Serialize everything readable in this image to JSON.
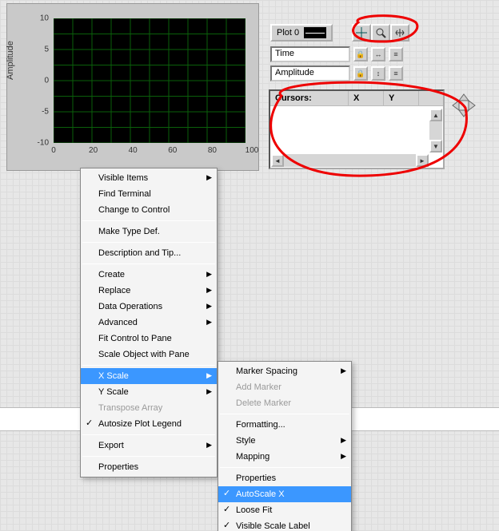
{
  "chart_data": {
    "type": "line",
    "series": [],
    "title": "",
    "xlabel": "Time",
    "ylabel": "Amplitude",
    "xlim": [
      0,
      100
    ],
    "ylim": [
      -10,
      10
    ],
    "xticks": [
      0,
      20,
      40,
      60,
      80,
      100
    ],
    "yticks": [
      -10,
      -5,
      0,
      5,
      10
    ],
    "grid": true,
    "grid_color": "#006400",
    "background": "#000000"
  },
  "legend": {
    "plot0": "Plot 0"
  },
  "palette": {
    "tools": [
      "crosshair-tool",
      "zoom-tool",
      "pan-tool"
    ]
  },
  "scales": {
    "x_label_field": "Time",
    "y_label_field": "Amplitude"
  },
  "cursor_table": {
    "header_cursors": "Cursors:",
    "header_x": "X",
    "header_y": "Y",
    "rows": []
  },
  "context_menu": {
    "items": {
      "visible_items": "Visible Items",
      "find_terminal": "Find Terminal",
      "change_to_control": "Change to Control",
      "make_type_def": "Make Type Def.",
      "description_tip": "Description and Tip...",
      "create": "Create",
      "replace": "Replace",
      "data_operations": "Data Operations",
      "advanced": "Advanced",
      "fit_control_to_pane": "Fit Control to Pane",
      "scale_object_with_pane": "Scale Object with Pane",
      "x_scale": "X Scale",
      "y_scale": "Y Scale",
      "transpose_array": "Transpose Array",
      "autosize_plot_legend": "Autosize Plot Legend",
      "export": "Export",
      "properties": "Properties"
    }
  },
  "xscale_submenu": {
    "items": {
      "marker_spacing": "Marker Spacing",
      "add_marker": "Add Marker",
      "delete_marker": "Delete Marker",
      "formatting": "Formatting...",
      "style": "Style",
      "mapping": "Mapping",
      "properties": "Properties",
      "autoscale_x": "AutoScale X",
      "loose_fit": "Loose Fit",
      "visible_scale_label": "Visible Scale Label"
    }
  }
}
